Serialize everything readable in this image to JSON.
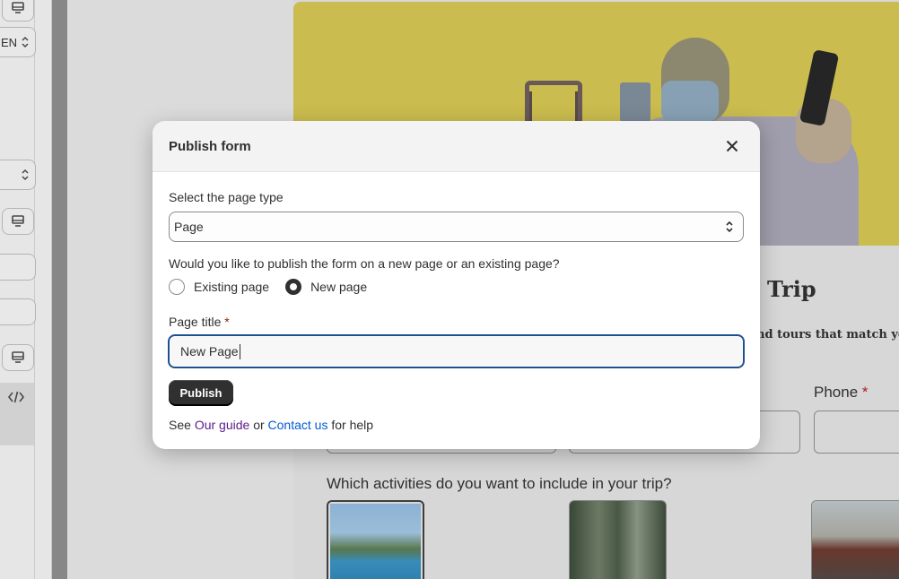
{
  "left_panel": {
    "lang_value": "EN"
  },
  "preview": {
    "title": "Trip",
    "subtitle": "nd tours that match your",
    "phone_label": "Phone",
    "phone_required": "*",
    "activities_question": "Which activities do you want to include in your trip?"
  },
  "modal": {
    "title": "Publish form",
    "page_type_label": "Select the page type",
    "page_type_value": "Page",
    "publish_question": "Would you like to publish the form on a new page or an existing page?",
    "options": [
      {
        "label": "Existing page",
        "checked": false
      },
      {
        "label": "New page",
        "checked": true
      }
    ],
    "page_title_label": "Page title",
    "required_mark": "*",
    "page_title_value": "New Page",
    "publish_button": "Publish",
    "help": {
      "prefix": "See",
      "guide_link": "Our guide",
      "or": "or",
      "contact_link": "Contact us",
      "suffix": "for help"
    }
  },
  "colors": {
    "primary_button": "#303030",
    "link_visited": "#5c1a8c",
    "link": "#005bd3",
    "focus_ring": "#1f4f8f",
    "required": "#8e1f0b"
  }
}
